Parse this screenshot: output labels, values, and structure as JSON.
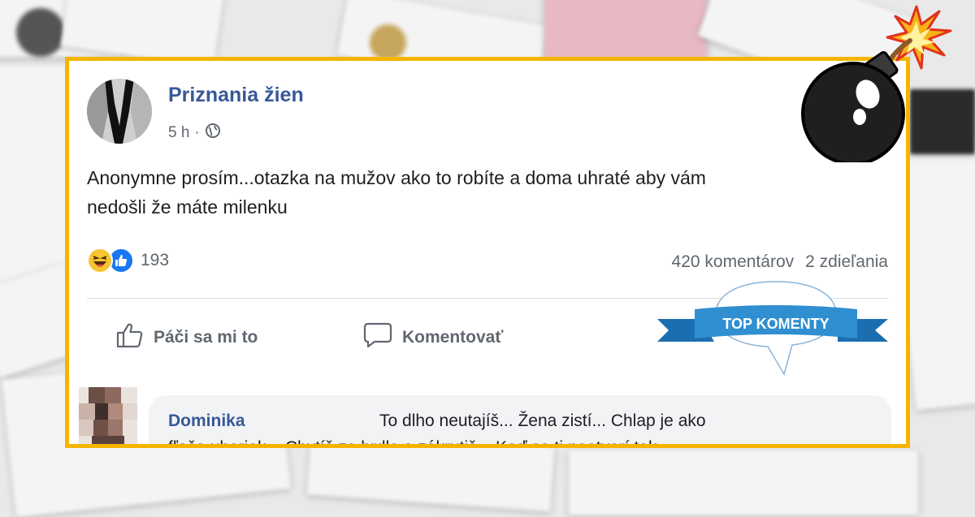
{
  "post": {
    "page_name": "Priznania žien",
    "time": "5 h",
    "separator": "·",
    "text_line1": "Anonymne prosím...otazka na mužov ako to robíte a doma uhraté aby vám",
    "text_line2": "nedošli že máte milenku"
  },
  "engagement": {
    "reaction_count": "193",
    "comments": "420 komentárov",
    "shares": "2 zdieľania"
  },
  "actions": {
    "like_label": "Páči sa mi to",
    "comment_label": "Komentovať"
  },
  "badge": {
    "label": "TOP KOMENTY"
  },
  "comment": {
    "author": "Dominika",
    "text_line1": "To dlho neutajíš... Žena zistí... Chlap je ako",
    "text_line2": "fľaša uhoriek... Chytíš za hrdlo a zákrutiš... Keď sa ti neotvorí tak"
  },
  "colors": {
    "frame": "#f5b400",
    "link": "#385898",
    "like_blue": "#1877f2",
    "ribbon": "#2f8fd0"
  },
  "icons": [
    "globe-icon",
    "haha-reaction-icon",
    "like-reaction-icon",
    "thumbs-up-icon",
    "comment-icon",
    "bomb-icon"
  ]
}
